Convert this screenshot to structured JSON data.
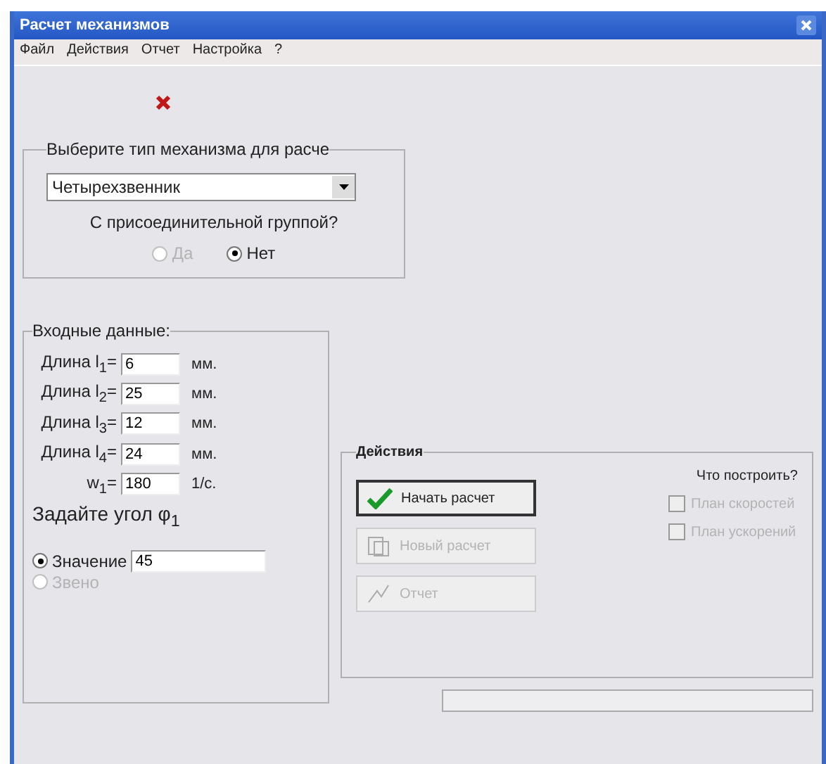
{
  "window": {
    "title": "Расчет механизмов"
  },
  "menu": [
    "Файл",
    "Действия",
    "Отчет",
    "Настройка",
    "?"
  ],
  "status_icon": {
    "kind": "error"
  },
  "mechanism": {
    "title": "Выберите тип механизма для расче",
    "dropdown": "Четырехзвенник",
    "question": "С присоединительной группой?",
    "options": [
      {
        "label": "Да",
        "selected": false,
        "disabled": true
      },
      {
        "label": "Нет",
        "selected": true,
        "disabled": false
      }
    ]
  },
  "inputs": {
    "title": "Входные данные:",
    "rows": [
      {
        "label": "Длина l$_{1}$=",
        "value": "6",
        "unit": "мм."
      },
      {
        "label": "Длина l$_{2}$=",
        "value": "25",
        "unit": "мм."
      },
      {
        "label": "Длина l$_{3}$=",
        "value": "12",
        "unit": "мм."
      },
      {
        "label": "Длина l$_{4}$=",
        "value": "24",
        "unit": "мм."
      },
      {
        "label": "w$_{1}$=",
        "value": "180",
        "unit": "1/c."
      }
    ],
    "angle_title": "Задайте угол φ$_{1}$",
    "angle_value": "45",
    "angle_options": [
      {
        "label": "Значение",
        "selected": true,
        "disabled": false
      },
      {
        "label": "Звено",
        "selected": false,
        "disabled": true
      }
    ]
  },
  "actions": {
    "title": "Действия",
    "buttons": [
      {
        "label": "Начать расчет",
        "kind": "check",
        "disabled": false
      },
      {
        "label": "Новый расчет",
        "kind": "new",
        "disabled": true
      },
      {
        "label": "Отчет",
        "kind": "report",
        "disabled": true
      }
    ],
    "build_title": "Что построить?",
    "checks": [
      {
        "label": "План скоростей",
        "checked": false,
        "disabled": true
      },
      {
        "label": "План ускорений",
        "checked": false,
        "disabled": true
      }
    ]
  }
}
